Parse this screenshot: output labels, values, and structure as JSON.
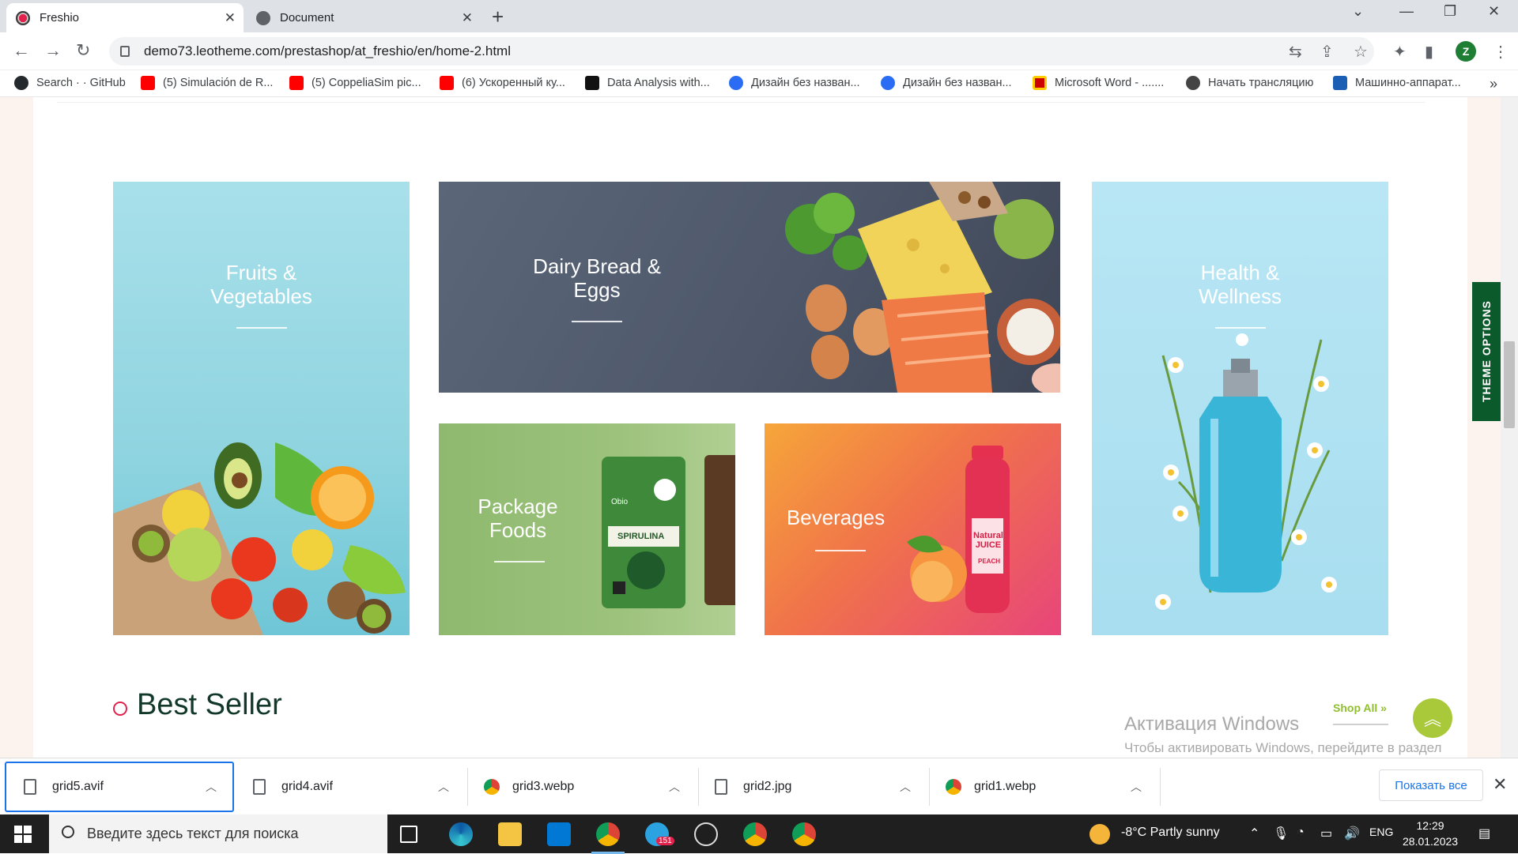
{
  "browser": {
    "tabs": [
      {
        "title": "Freshio",
        "active": true
      },
      {
        "title": "Document",
        "active": false
      }
    ],
    "url": "demo73.leotheme.com/prestashop/at_freshio/en/home-2.html",
    "profile_initial": "Z",
    "bookmarks": [
      "Search · · GitHub",
      "(5) Simulación de R...",
      "(5) CoppeliaSim pic...",
      "(6) Ускоренный ку...",
      "Data Analysis with...",
      "Дизайн без назван...",
      "Дизайн без назван...",
      "Microsoft Word - .......",
      "Начать трансляцию",
      "Машинно-аппарат..."
    ],
    "bookmarks_more": "»"
  },
  "page": {
    "categories": [
      {
        "title": "Fruits &\nVegetables"
      },
      {
        "title": "Dairy Bread &\nEggs"
      },
      {
        "title": "Package\nFoods"
      },
      {
        "title": "Beverages"
      },
      {
        "title": "Health &\nWellness"
      }
    ],
    "theme_options": "THEME OPTIONS",
    "section_title": "Best Seller",
    "shop_all": "Shop All »",
    "product_labels": {
      "spirulina": "SPIRULINA",
      "juice": "Natural\nJUICE",
      "juice_flavor": "PEACH",
      "brand": "Obio"
    },
    "watermark": {
      "title": "Активация Windows",
      "text": "Чтобы активировать Windows, перейдите в раздел \"Параметры\"."
    }
  },
  "downloads": {
    "files": [
      "grid5.avif",
      "grid4.avif",
      "grid3.webp",
      "grid2.jpg",
      "grid1.webp"
    ],
    "show_all": "Показать все"
  },
  "taskbar": {
    "search_placeholder": "Введите здесь текст для поиска",
    "weather": "-8°C  Partly sunny",
    "lang": "ENG",
    "time": "12:29",
    "date": "28.01.2023",
    "telegram_badge": "151"
  },
  "colors": {
    "brand_green": "#0b5a2c",
    "accent_lime": "#a9c93a",
    "accent_red": "#e0224c"
  }
}
